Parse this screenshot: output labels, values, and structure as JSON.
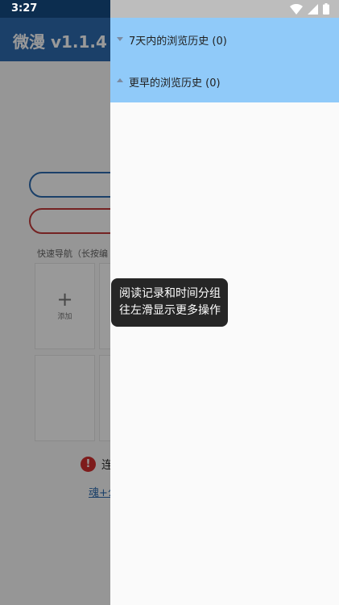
{
  "status_bar": {
    "time": "3:27"
  },
  "app": {
    "title": "微漫 v1.1.4",
    "quick_nav_label": "快速导航（长按编",
    "add_tile_label": "添加",
    "connection_status": "连",
    "link_text": "魂+公"
  },
  "drawer": {
    "groups": [
      {
        "label": "7天内的浏览历史 (0)"
      },
      {
        "label": "更早的浏览历史 (0)"
      }
    ]
  },
  "tooltip": {
    "line1": "阅读记录和时间分组",
    "line2": "往左滑显示更多操作"
  },
  "colors": {
    "app_bar": "#2d6bb0",
    "drawer_header": "#90caf9",
    "tooltip_bg": "#262626",
    "warning": "#d32f2f"
  },
  "icons": [
    "wifi-icon",
    "signal-icon",
    "battery-icon",
    "add-icon",
    "warning-icon",
    "expand-triangle-icon"
  ]
}
